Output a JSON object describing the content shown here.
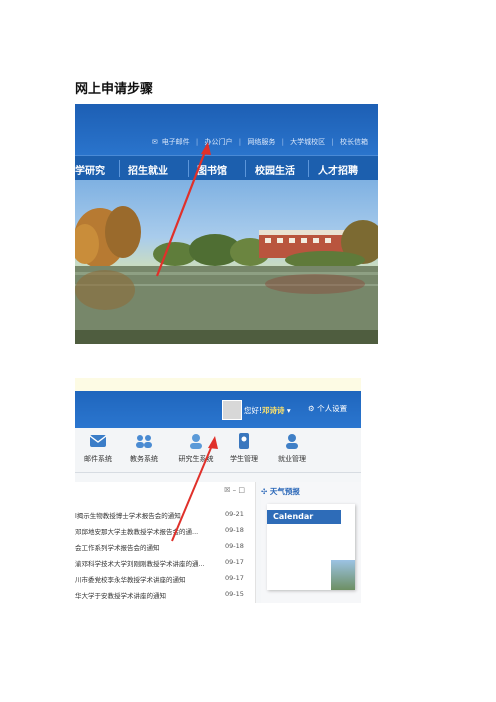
{
  "title": "网上申请步骤",
  "shot1": {
    "top_links": [
      "电子邮件",
      "办公门户",
      "网络服务",
      "大学城校区",
      "校长信箱"
    ],
    "nav": [
      "学研究",
      "招生就业",
      "图书馆",
      "校园生活",
      "人才招聘"
    ]
  },
  "shot2": {
    "greeting": "您好!",
    "username": "邓诗诗",
    "settings": "个人设置",
    "apps": [
      {
        "label": "邮件系统",
        "icon": "mail-icon"
      },
      {
        "label": "教务系统",
        "icon": "people-icon"
      },
      {
        "label": "研究生系统",
        "icon": "graduate-icon"
      },
      {
        "label": "学生管理",
        "icon": "student-icon"
      },
      {
        "label": "就业管理",
        "icon": "employment-icon"
      }
    ],
    "list_controls": "☒ – □",
    "notices": [
      {
        "text": "l揭示生物教授博士学术报告会的通知",
        "date": "09-21"
      },
      {
        "text": "邓邱地安那大学主教教授学术报告会的通...",
        "date": "09-18"
      },
      {
        "text": "会工作系列学术报告会的通知",
        "date": "09-18"
      },
      {
        "text": "渝邓科学技术大学刘刚刚教授学术讲座的通...",
        "date": "09-17"
      },
      {
        "text": "川市委党校李永华教授学术讲座的通知",
        "date": "09-17"
      },
      {
        "text": "华大学于安教授学术讲座的通知",
        "date": "09-15"
      }
    ],
    "weather": "天气预报",
    "calendar": "Calendar"
  },
  "colors": {
    "header_blue": "#1d5fb4",
    "arrow_red": "#e0302a"
  }
}
